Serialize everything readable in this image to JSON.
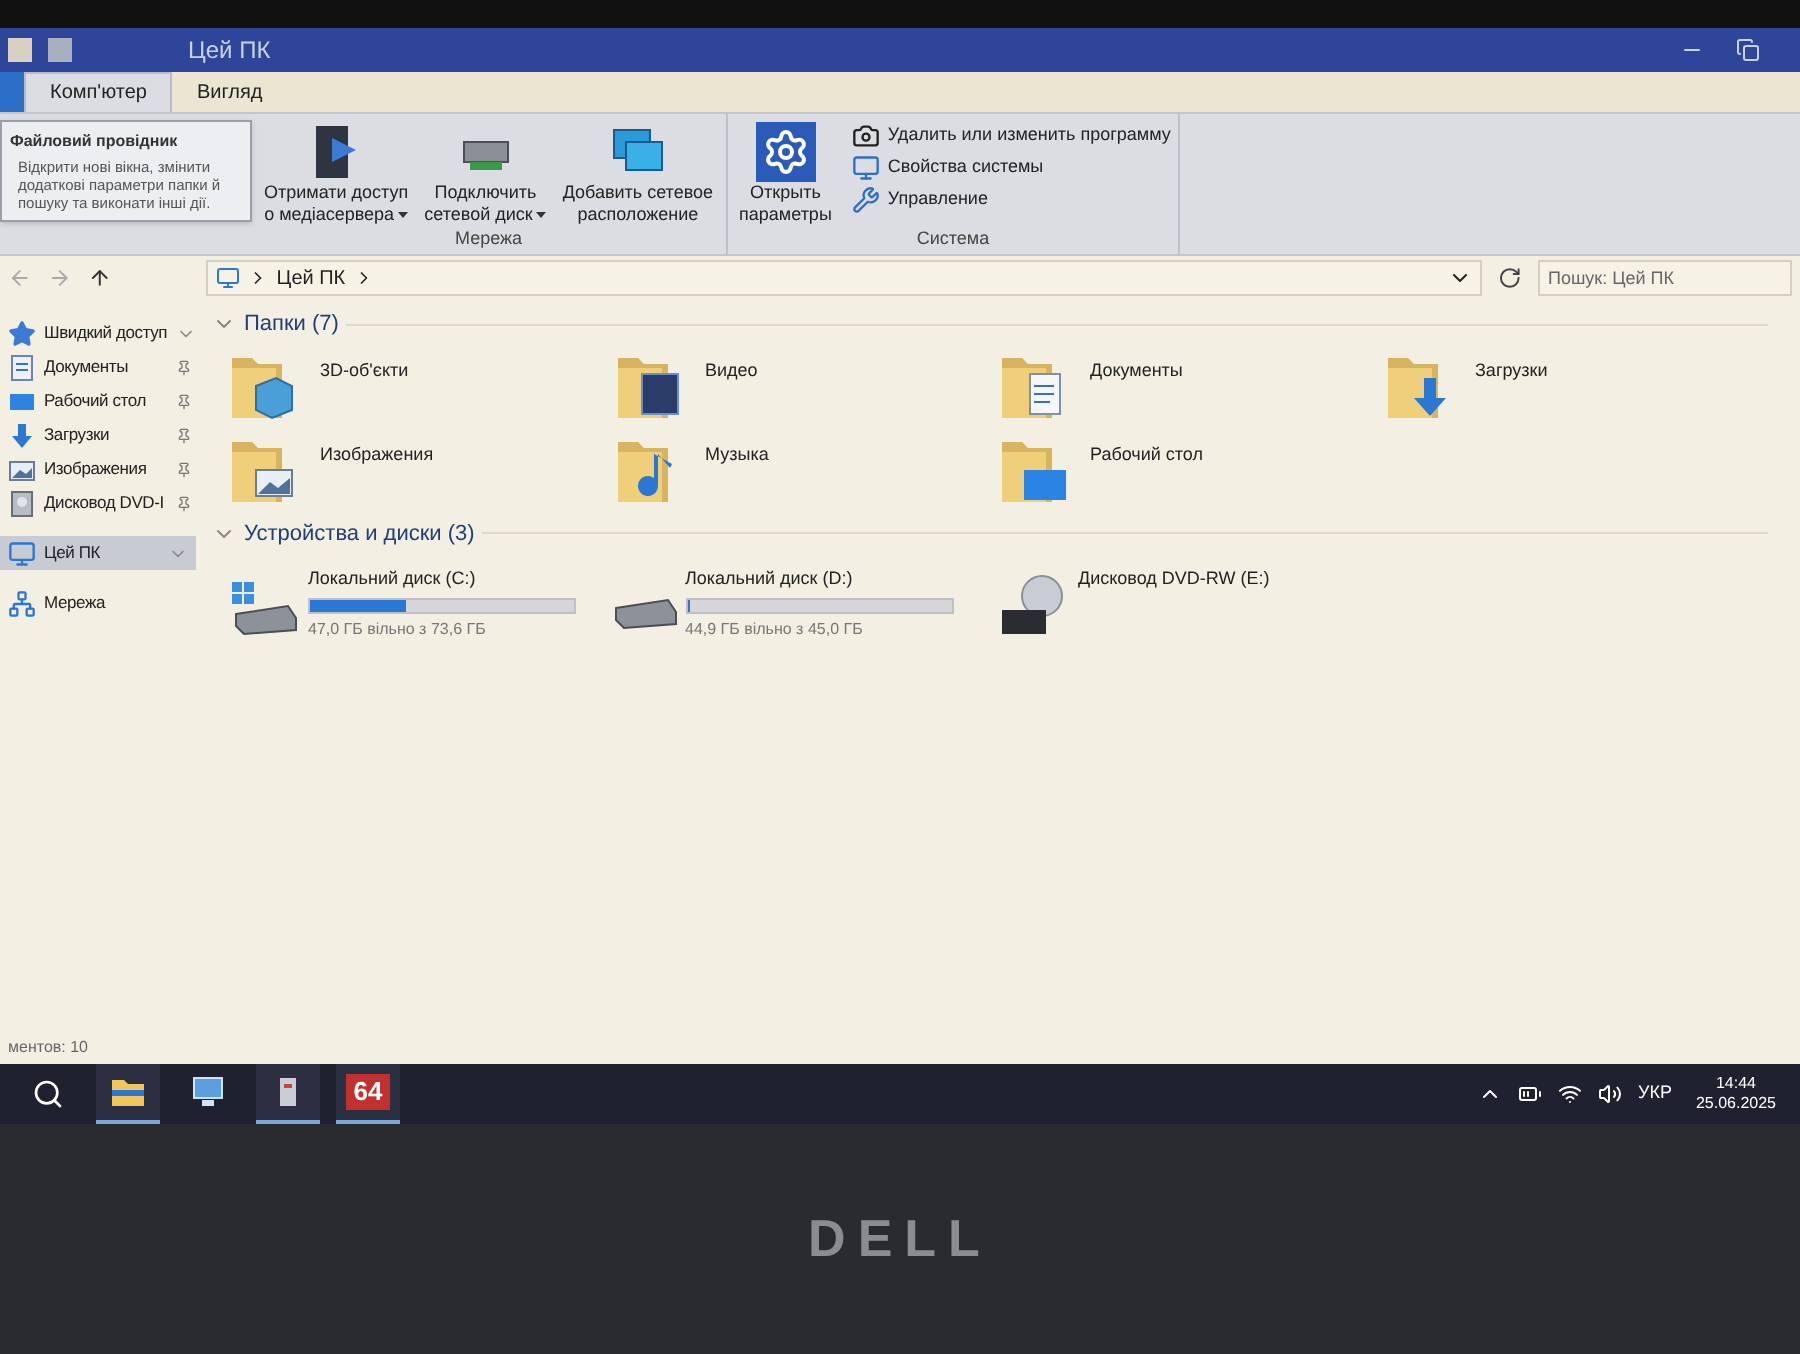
{
  "window": {
    "title": "Цей ПК"
  },
  "ribbon_tabs": [
    {
      "label": "Комп'ютер",
      "selected": true
    },
    {
      "label": "Вигляд",
      "selected": false
    }
  ],
  "tooltip": {
    "title": "Файловий провідник",
    "description": "Відкрити нові вікна, змінити додаткові параметри папки й пошуку та виконати інші дії."
  },
  "ribbon_groups": [
    {
      "label": "Мережа",
      "buttons": [
        {
          "kind": "media",
          "lines": [
            "Отримати доступ",
            "о медіасервера"
          ],
          "dropdown": true
        },
        {
          "kind": "drive",
          "lines": [
            "Подключить",
            "сетевой диск"
          ],
          "dropdown": true
        },
        {
          "kind": "location",
          "lines": [
            "Добавить сетевое",
            "расположение"
          ],
          "dropdown": false
        }
      ]
    },
    {
      "label": "Система",
      "buttons": [
        {
          "kind": "settings",
          "lines": [
            "Открыть",
            "параметры"
          ],
          "dropdown": false
        }
      ],
      "small_buttons": [
        {
          "kind": "uninstall",
          "label": "Удалить или изменить программу"
        },
        {
          "kind": "system",
          "label": "Свойства системы"
        },
        {
          "kind": "manage",
          "label": "Управление"
        }
      ]
    }
  ],
  "address_bar": {
    "path": "Цей ПК"
  },
  "search": {
    "placeholder": "Пошук: Цей ПК"
  },
  "nav_pane": [
    {
      "kind": "star",
      "label": "Швидкий доступ",
      "selected": false,
      "expanded": true,
      "children": [
        {
          "kind": "documents",
          "label": "Документы",
          "selected": false,
          "pinned": true
        },
        {
          "kind": "desktop",
          "label": "Рабочий стол",
          "selected": false,
          "pinned": true
        },
        {
          "kind": "downloads",
          "label": "Загрузки",
          "selected": false,
          "pinned": true
        },
        {
          "kind": "pictures",
          "label": "Изображения",
          "selected": false,
          "pinned": true
        },
        {
          "kind": "dvd",
          "label": "Дисковод DVD-I",
          "selected": false,
          "pinned": true
        }
      ]
    },
    {
      "kind": "pc",
      "label": "Цей ПК",
      "selected": true,
      "expanded": true
    },
    {
      "kind": "network",
      "label": "Мережа",
      "selected": false,
      "expanded": false
    }
  ],
  "sections": [
    {
      "title": "Папки (7)",
      "expanded": true,
      "items": [
        {
          "kind": "objects",
          "label": "3D-об'єкти"
        },
        {
          "kind": "video",
          "label": "Видео"
        },
        {
          "kind": "documents",
          "label": "Документы"
        },
        {
          "kind": "downloads",
          "label": "Загрузки"
        },
        {
          "kind": "pictures",
          "label": "Изображения"
        },
        {
          "kind": "music",
          "label": "Музыка"
        },
        {
          "kind": "desktop",
          "label": "Рабочий стол"
        }
      ]
    },
    {
      "title": "Устройства и диски (3)",
      "expanded": true,
      "items": [
        {
          "kind": "system_drive",
          "label": "Локальний диск (C:)",
          "level": 0.36,
          "detail": "47,0 ГБ вільно з 73,6 ГБ"
        },
        {
          "kind": "drive",
          "label": "Локальний диск (D:)",
          "level": 0.01,
          "detail": "44,9 ГБ вільно з 45,0 ГБ"
        },
        {
          "kind": "dvd",
          "label": "Дисковод DVD-RW (E:)"
        }
      ]
    }
  ],
  "status_bar": {
    "text": "ментов: 10"
  },
  "taskbar": {
    "apps": [
      {
        "kind": "explorer",
        "active": true
      },
      {
        "kind": "network",
        "active": false
      },
      {
        "kind": "server",
        "active": true
      },
      {
        "kind": "badge",
        "label": "64",
        "active": true
      }
    ],
    "language": "УКР",
    "time": "14:44",
    "date": "25.06.2025"
  },
  "bezel": {
    "logo": "DELL"
  }
}
